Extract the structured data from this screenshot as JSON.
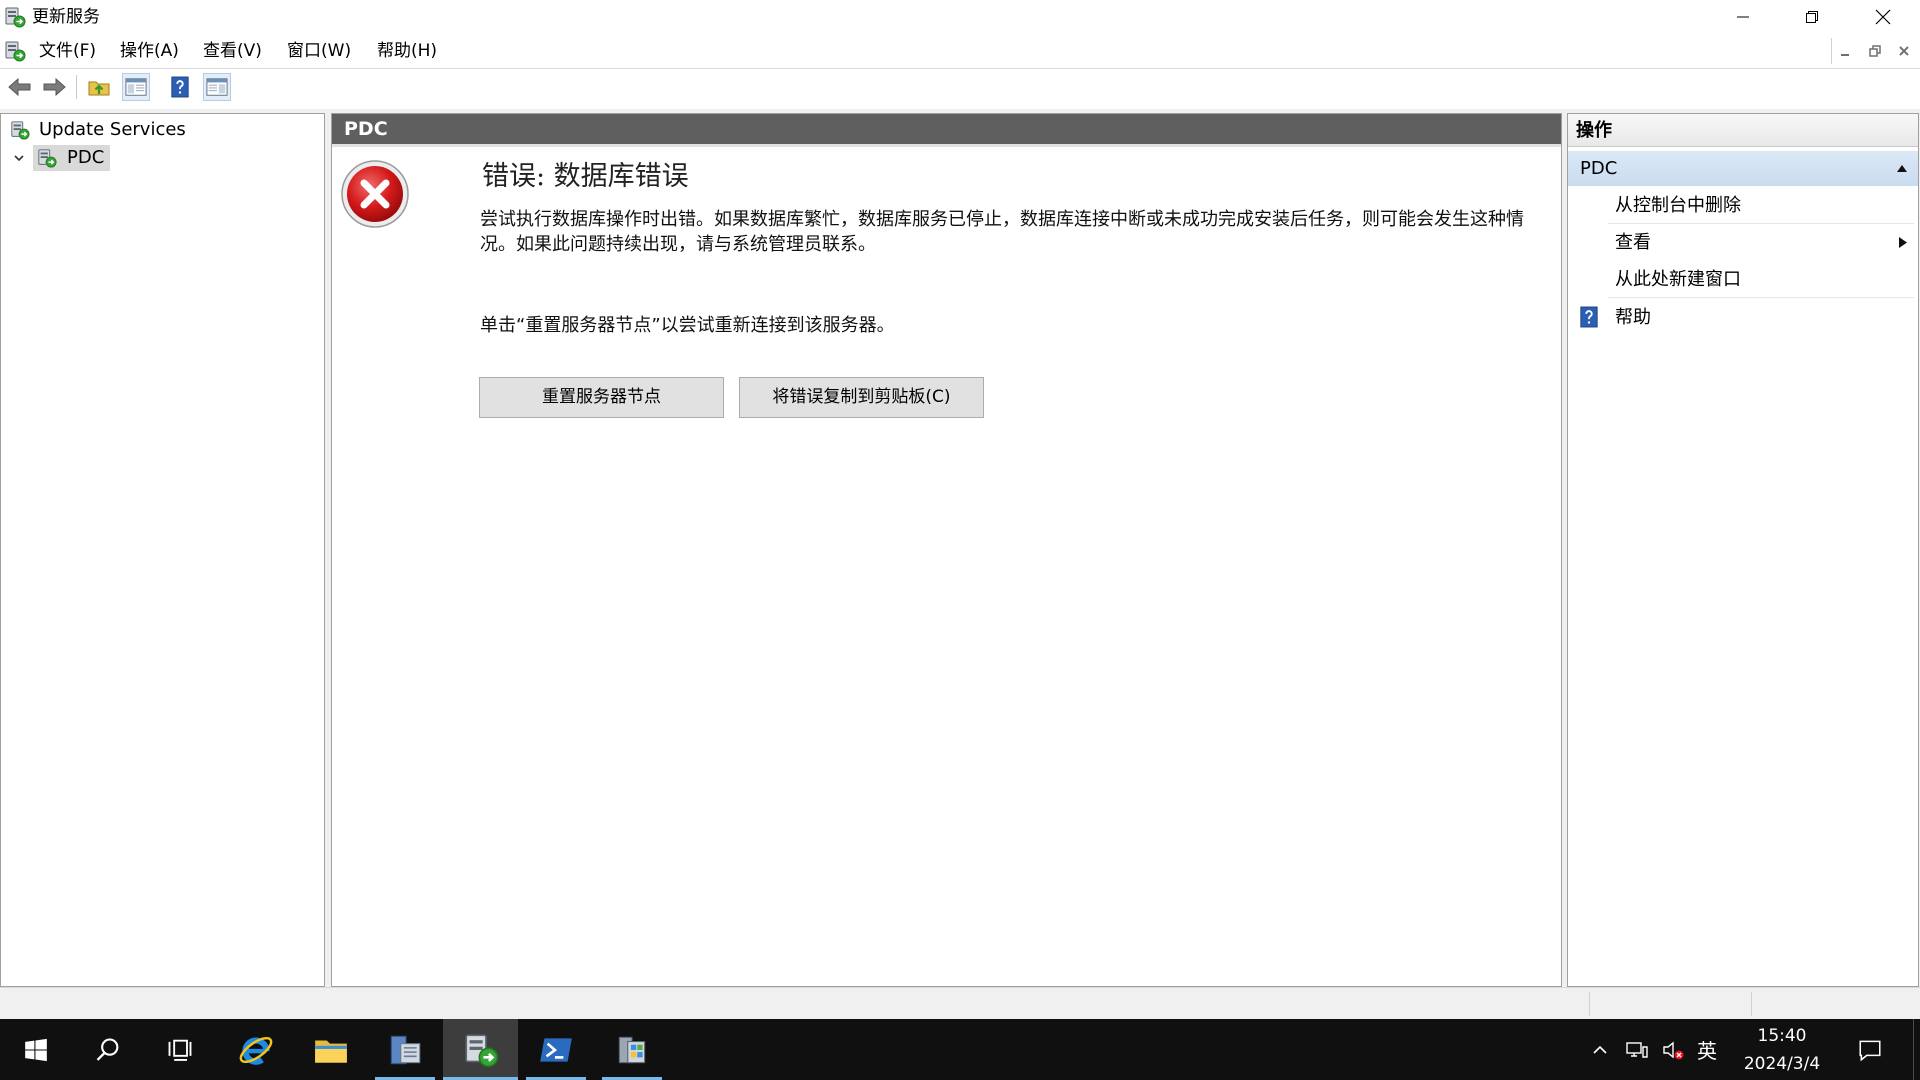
{
  "window": {
    "title": "更新服务",
    "controls": [
      "minimize-icon",
      "restore-icon",
      "close-icon"
    ]
  },
  "menu": {
    "items": [
      "文件(F)",
      "操作(A)",
      "查看(V)",
      "窗口(W)",
      "帮助(H)"
    ]
  },
  "toolbar": {
    "icons": [
      "back-arrow-icon",
      "forward-arrow-icon",
      "up-one-level-icon",
      "show-hide-console-tree-icon",
      "help-icon",
      "show-hide-action-pane-icon"
    ],
    "checked": [
      "show-hide-console-tree-icon",
      "show-hide-action-pane-icon"
    ]
  },
  "tree": {
    "root_label": "Update Services",
    "selected_node": "PDC"
  },
  "content": {
    "header": "PDC",
    "error_title": "错误: 数据库错误",
    "error_message": "尝试执行数据库操作时出错。如果数据库繁忙，数据库服务已停止，数据库连接中断或未成功完成安装后任务，则可能会发生这种情况。如果此问题持续出现，请与系统管理员联系。",
    "instruction": "单击“重置服务器节点”以尝试重新连接到该服务器。",
    "reset_button": "重置服务器节点",
    "copy_button": "将错误复制到剪贴板(C)"
  },
  "actions": {
    "header": "操作",
    "section": "PDC",
    "items": [
      "从控制台中删除",
      "查看",
      "从此处新建窗口",
      "帮助"
    ]
  },
  "taskbar": {
    "apps": [
      "start-icon",
      "search-icon",
      "task-view-icon",
      "internet-explorer-icon",
      "file-explorer-icon",
      "server-manager-icon",
      "update-services-icon",
      "powershell-icon",
      "server-tool-icon"
    ],
    "active_app": "update-services-icon",
    "ime": "英",
    "time": "15:40",
    "date": "2024/3/4"
  },
  "colors": {
    "content_header_bg": "#5f5f5f",
    "actions_section_bg": "#c9dcf0",
    "taskbar_bg": "#101010",
    "running_indicator": "#76b9ed",
    "active_slot": "#3d3d3d",
    "tree_selection_bg": "#d9d9d9"
  }
}
